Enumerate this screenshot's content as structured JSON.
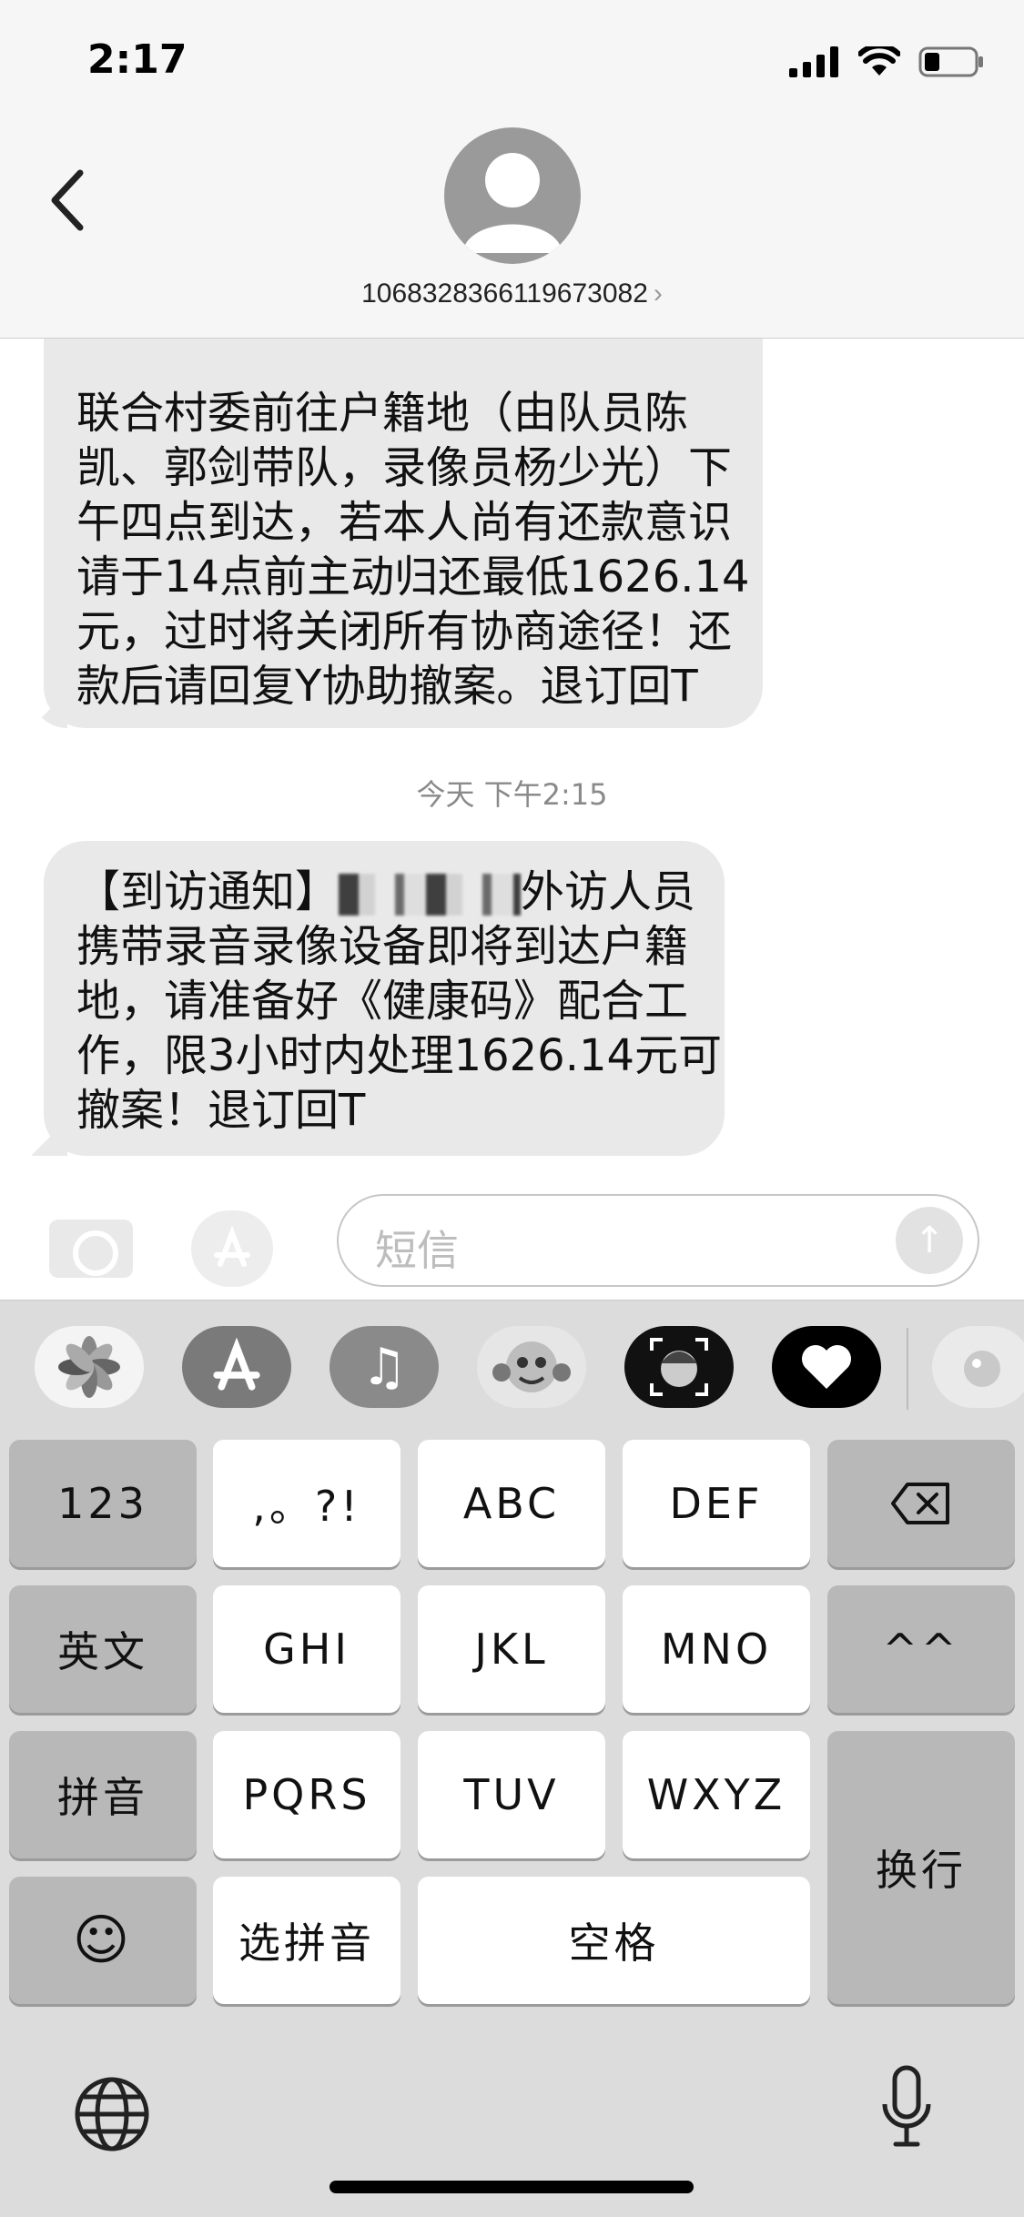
{
  "status_bar": {
    "time": "2:17"
  },
  "header": {
    "contact": "1068328366119673082",
    "chevron": "›"
  },
  "messages": {
    "first_text": "联合村委前往户籍地（由队员陈凯、郭剑带队，录像员杨少光）下午四点到达，若本人尚有还款意识请于14点前主动归还最低1626.14元，过时将关闭所有协商途径！还款后请回复Y协助撤案。退订回T",
    "timestamp": "今天 下午2:15",
    "second_prefix": "【到访通知】",
    "second_text": "外访人员携带录音录像设备即将到达户籍地，请准备好《健康码》配合工作，限3小时内处理1626.14元可撤案！退订回T"
  },
  "input": {
    "placeholder": "短信"
  },
  "keyboard": {
    "row1": [
      "123",
      ",。?!",
      "ABC",
      "DEF"
    ],
    "row2": [
      "英文",
      "GHI",
      "JKL",
      "MNO",
      "^^"
    ],
    "row3": [
      "拼音",
      "PQRS",
      "TUV",
      "WXYZ"
    ],
    "row4": [
      "选拼音",
      "空格"
    ],
    "return_label": "换行",
    "emoji": "☺"
  },
  "icons": {
    "back": "chevron-left-icon",
    "avatar": "person-icon",
    "camera": "camera-icon",
    "app_store": "app-store-icon",
    "send": "arrow-up-icon",
    "delete": "delete-icon",
    "globe": "globe-icon",
    "mic": "microphone-icon"
  }
}
